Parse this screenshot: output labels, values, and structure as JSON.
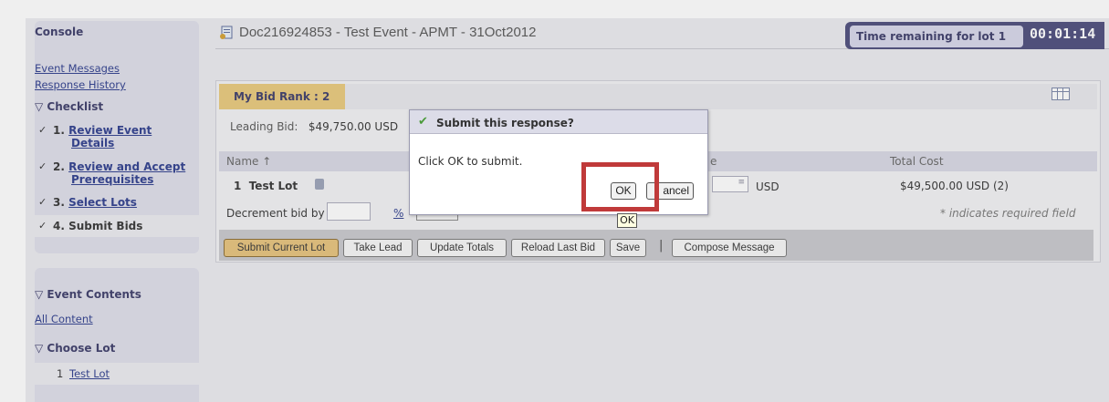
{
  "sidebar": {
    "console_title": "Console",
    "links": [
      "Event Messages",
      "Response History"
    ],
    "checklist_heading": "Checklist",
    "checklist": [
      {
        "num": "1.",
        "label": "Review Event",
        "label2": "Details"
      },
      {
        "num": "2.",
        "label": "Review and Accept",
        "label2": "Prerequisites"
      },
      {
        "num": "3.",
        "label": "Select Lots",
        "label2": ""
      },
      {
        "num": "4.",
        "label": "Submit Bids",
        "label2": ""
      }
    ],
    "event_contents_heading": "Event Contents",
    "all_content": "All Content",
    "choose_lot_heading": "Choose Lot",
    "lot_item": {
      "num": "1",
      "label": "Test Lot"
    }
  },
  "header": {
    "doc_title": "Doc216924853 - Test Event - APMT - 31Oct2012",
    "timer_label": "Time remaining for lot 1",
    "timer_value": "00:01:14"
  },
  "main": {
    "rank_tab": "My Bid Rank : 2",
    "leading_label": "Leading Bid:",
    "leading_value": "$49,750.00 USD",
    "col_name": "Name ↑",
    "col_price": "e",
    "col_total": "Total Cost",
    "lot_num": "1",
    "lot_name": "Test Lot",
    "currency": "USD",
    "total_cost": "$49,500.00 USD (2)",
    "decrement_label": "Decrement bid by",
    "percent": "%",
    "required_note": "* indicates required field"
  },
  "actions": {
    "submit_current_lot": "Submit Current Lot",
    "take_lead": "Take Lead",
    "update_totals": "Update Totals",
    "reload_last_bid": "Reload Last Bid",
    "save": "Save",
    "separator": "|",
    "compose_message": "Compose Message"
  },
  "dialog": {
    "title": "Submit this response?",
    "message": "Click OK to submit.",
    "ok_label": "OK",
    "cancel_label": "ancel",
    "tooltip": "OK"
  },
  "colors": {
    "accent_tab": "#e9c97a",
    "timer_bg": "#4a4a7a",
    "highlight": "#c03a3a"
  }
}
